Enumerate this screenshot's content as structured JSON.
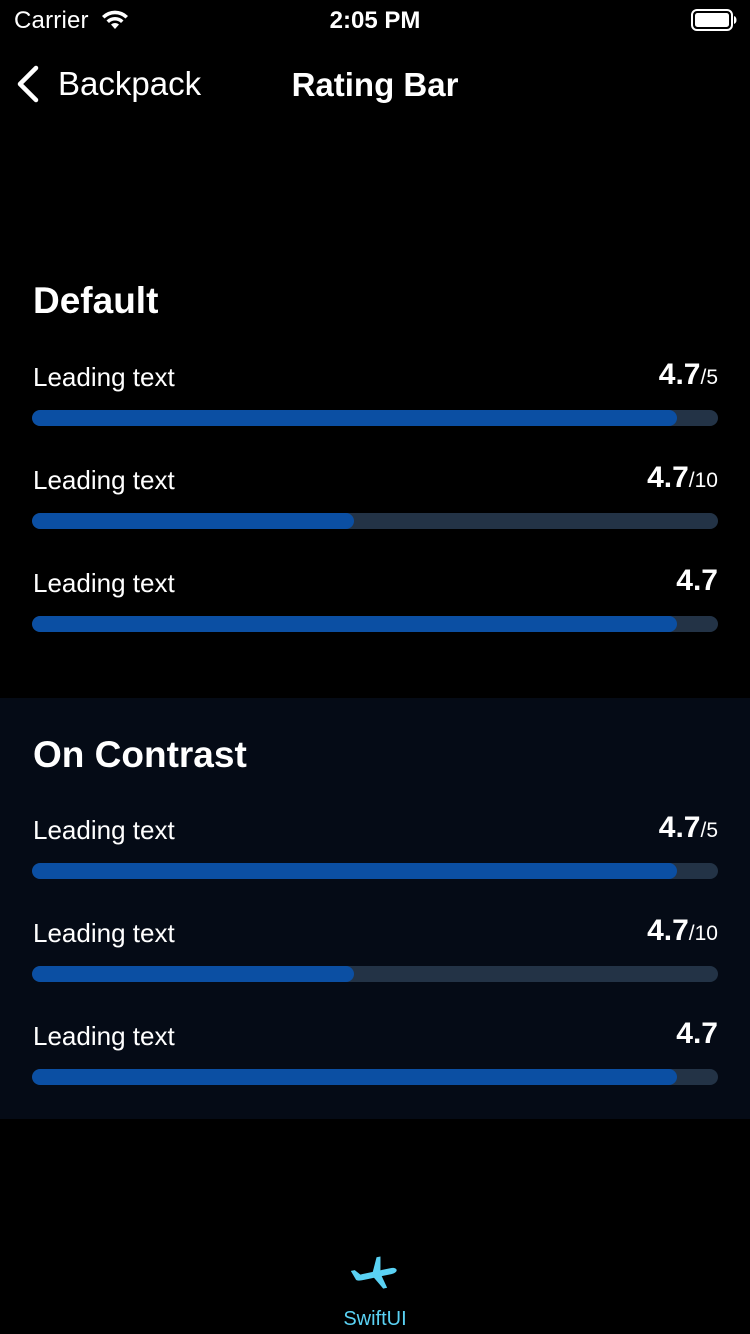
{
  "status_bar": {
    "carrier": "Carrier",
    "time": "2:05 PM"
  },
  "nav": {
    "back_label": "Backpack",
    "title": "Rating Bar"
  },
  "sections": [
    {
      "title": "Default",
      "rows": [
        {
          "label": "Leading text",
          "value": "4.7",
          "scale": "/5",
          "fill_fraction": 0.94
        },
        {
          "label": "Leading text",
          "value": "4.7",
          "scale": "/10",
          "fill_fraction": 0.47
        },
        {
          "label": "Leading text",
          "value": "4.7",
          "scale": "",
          "fill_fraction": 0.94
        }
      ]
    },
    {
      "title": "On Contrast",
      "rows": [
        {
          "label": "Leading text",
          "value": "4.7",
          "scale": "/5",
          "fill_fraction": 0.94
        },
        {
          "label": "Leading text",
          "value": "4.7",
          "scale": "/10",
          "fill_fraction": 0.47
        },
        {
          "label": "Leading text",
          "value": "4.7",
          "scale": "",
          "fill_fraction": 0.94
        }
      ]
    }
  ],
  "tab_bar": {
    "item_label": "SwiftUI",
    "item_icon": "airplane-icon"
  },
  "colors": {
    "bar_fill": "#0b4fa3",
    "bar_track": "#233346",
    "contrast_background": "#050b16",
    "tab_accent": "#5ad2f4"
  }
}
